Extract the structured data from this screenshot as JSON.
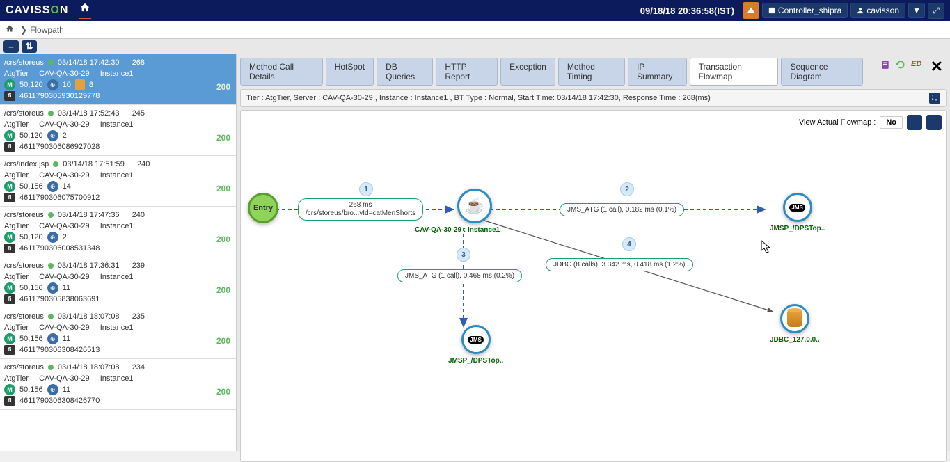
{
  "header": {
    "logo_prefix": "CAVISS",
    "logo_o": "O",
    "logo_suffix": "N",
    "timestamp": "09/18/18 20:36:58(IST)",
    "controller_btn": "Controller_shipra",
    "user_btn": "cavisson"
  },
  "breadcrumb": {
    "item": "Flowpath"
  },
  "sidebar": {
    "items": [
      {
        "url": "/crs/storeus",
        "ts": "03/14/18 17:42:30",
        "respTime": "268",
        "tier": "AtgTier",
        "server": "CAV-QA-30-29",
        "instance": "Instance1",
        "mval": "50,120",
        "bval": "10",
        "dbval": "8",
        "fpid": "4611790305930129778",
        "status": "200",
        "active": true,
        "hasDb": true
      },
      {
        "url": "/crs/storeus",
        "ts": "03/14/18 17:52:43",
        "respTime": "245",
        "tier": "AtgTier",
        "server": "CAV-QA-30-29",
        "instance": "Instance1",
        "mval": "50,120",
        "bval": "2",
        "fpid": "4611790306086927028",
        "status": "200"
      },
      {
        "url": "/crs/index.jsp",
        "ts": "03/14/18 17:51:59",
        "respTime": "240",
        "tier": "AtgTier",
        "server": "CAV-QA-30-29",
        "instance": "Instance1",
        "mval": "50,156",
        "bval": "14",
        "fpid": "4611790306075700912",
        "status": "200"
      },
      {
        "url": "/crs/storeus",
        "ts": "03/14/18 17:47:36",
        "respTime": "240",
        "tier": "AtgTier",
        "server": "CAV-QA-30-29",
        "instance": "Instance1",
        "mval": "50,120",
        "bval": "2",
        "fpid": "4611790306008531348",
        "status": "200"
      },
      {
        "url": "/crs/storeus",
        "ts": "03/14/18 17:36:31",
        "respTime": "239",
        "tier": "AtgTier",
        "server": "CAV-QA-30-29",
        "instance": "Instance1",
        "mval": "50,156",
        "bval": "11",
        "fpid": "4611790305838063691",
        "status": "200"
      },
      {
        "url": "/crs/storeus",
        "ts": "03/14/18 18:07:08",
        "respTime": "235",
        "tier": "AtgTier",
        "server": "CAV-QA-30-29",
        "instance": "Instance1",
        "mval": "50,156",
        "bval": "11",
        "fpid": "4611790306308426513",
        "status": "200"
      },
      {
        "url": "/crs/storeus",
        "ts": "03/14/18 18:07:08",
        "respTime": "234",
        "tier": "AtgTier",
        "server": "CAV-QA-30-29",
        "instance": "Instance1",
        "mval": "50,156",
        "bval": "11",
        "fpid": "4611790306308426770",
        "status": "200"
      }
    ]
  },
  "tabs": {
    "items": [
      "Method Call Details",
      "HotSpot",
      "DB Queries",
      "HTTP Report",
      "Exception",
      "Method Timing",
      "IP Summary",
      "Transaction Flowmap",
      "Sequence Diagram"
    ]
  },
  "infobar": "Tier : AtgTier,  Server : CAV-QA-30-29 ,  Instance : Instance1 ,  BT Type : Normal, Start Time: 03/14/18 17:42:30, Response Time : 268(ms)",
  "flowmap": {
    "toolbar_label": "View Actual Flowmap :",
    "toolbar_no": "No",
    "nodes": {
      "entry": "Entry",
      "java": "CAV-QA-30-29 : Instance1",
      "jms_right": "JMSP_/DPSTop..",
      "jms_bottom": "JMSP_/DPSTop..",
      "db": "JDBC_127.0.0.."
    },
    "edges": {
      "e1_top": "268 ms",
      "e1_bottom": "/crs/storeus/bro...yId=catMenShorts",
      "e2": "JMS_ATG (1 call), 0.182 ms (0.1%)",
      "e3": "JMS_ATG (1 call), 0.468 ms (0.2%)",
      "e4": "JDBC (8 calls), 3.342 ms, 0.418 ms (1.2%)"
    },
    "seq": {
      "s1": "1",
      "s2": "2",
      "s3": "3",
      "s4": "4"
    },
    "tab_ed": "ED"
  }
}
